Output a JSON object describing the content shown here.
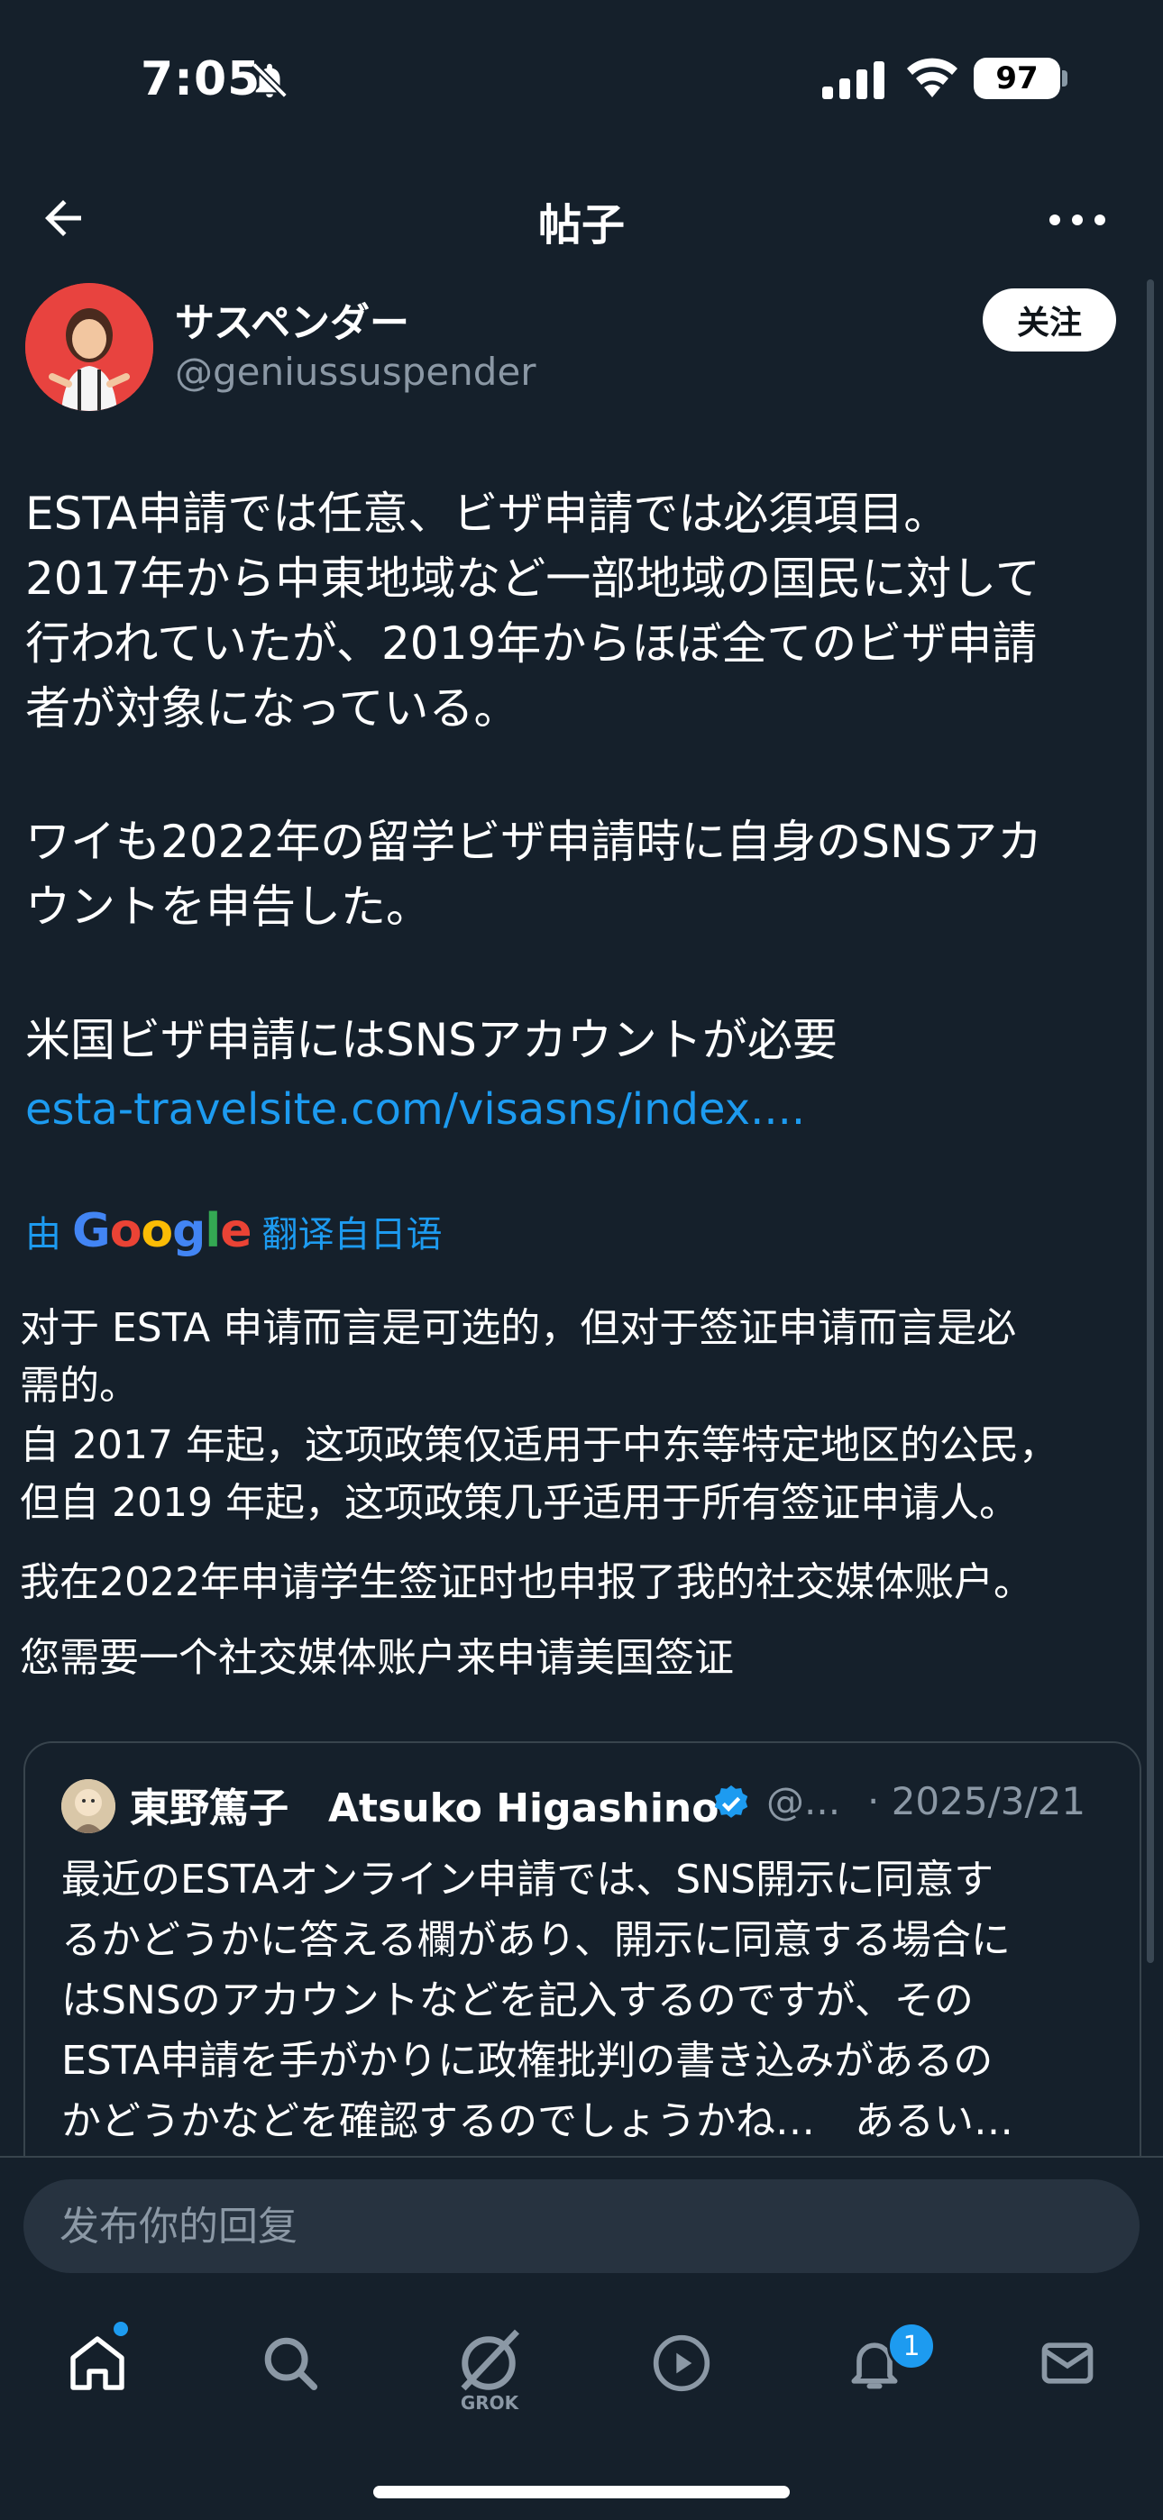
{
  "status_bar": {
    "time": "7:05",
    "battery": "97"
  },
  "header": {
    "title": "帖子"
  },
  "author": {
    "name": "サスペンダー",
    "handle": "@geniussuspender",
    "follow_label": "关注"
  },
  "post": {
    "lines": [
      "ESTA申請では任意、ビザ申請では必須項目。",
      "2017年から中東地域など一部地域の国民に対して",
      "行われていたが、2019年からほぼ全てのビザ申請",
      "者が対象になっている。",
      "ワイも2022年の留学ビザ申請時に自身のSNSアカ",
      "ウントを申告した。",
      "米国ビザ申請にはSNSアカウントが必要"
    ],
    "link": "esta-travelsite.com/visasns/index...."
  },
  "translation": {
    "prefix": "由",
    "provider": "Google",
    "suffix": "翻译自日语",
    "lines": [
      "对于 ESTA 申请而言是可选的，但对于签证申请而言是必",
      "需的。",
      "自 2017 年起，这项政策仅适用于中东等特定地区的公民，",
      "但自 2019 年起，这项政策几乎适用于所有签证申请人。",
      "我在2022年申请学生签证时也申报了我的社交媒体账户。",
      "您需要一个社交媒体账户来申请美国签证"
    ]
  },
  "quote": {
    "name": "東野篤子　Atsuko Higashino",
    "handle": "@...",
    "date": "· 2025/3/21",
    "lines": [
      "最近のESTAオンライン申請では、SNS開示に同意す",
      "るかどうかに答える欄があり、開示に同意する場合に",
      "はSNSのアカウントなどを記入するのですが、その",
      "ESTA申請を手がかりに政権批判の書き込みがあるの",
      "かどうかなどを確認するのでしょうかね…　あるい…"
    ]
  },
  "reply": {
    "placeholder": "发布你的回复"
  },
  "nav": {
    "grok_label": "GROK",
    "notifications_count": "1"
  },
  "colors": {
    "background": "#15202b",
    "accent": "#1d9bf0",
    "muted_text": "#8b98a5"
  },
  "icons": [
    "bell-off-icon",
    "signal-icon",
    "wifi-icon",
    "back-arrow-icon",
    "more-icon",
    "verified-icon",
    "home-icon",
    "search-icon",
    "grok-icon",
    "play-icon",
    "bell-icon",
    "mail-icon"
  ]
}
